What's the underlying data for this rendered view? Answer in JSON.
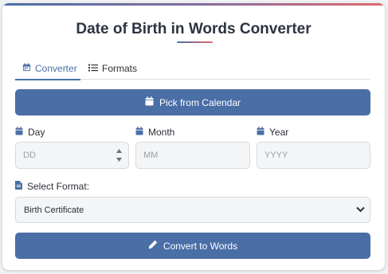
{
  "app": {
    "title": "Date of Birth in Words Converter"
  },
  "tabs": [
    {
      "label": "Converter",
      "icon": "calendar-icon",
      "active": true
    },
    {
      "label": "Formats",
      "icon": "list-icon",
      "active": false
    }
  ],
  "calendar_button": {
    "label": "Pick from Calendar",
    "icon": "calendar-icon"
  },
  "fields": {
    "day": {
      "label": "Day",
      "placeholder": "DD",
      "value": ""
    },
    "month": {
      "label": "Month",
      "placeholder": "MM",
      "value": ""
    },
    "year": {
      "label": "Year",
      "placeholder": "YYYY",
      "value": ""
    }
  },
  "format": {
    "label": "Select Format:",
    "icon": "document-icon",
    "selected": "Birth Certificate"
  },
  "convert_button": {
    "label": "Convert to Words",
    "icon": "pencil-icon"
  },
  "colors": {
    "accent": "#4a6ea6",
    "gradient_end": "#e06a70",
    "input_bg": "#f4f5f7"
  }
}
